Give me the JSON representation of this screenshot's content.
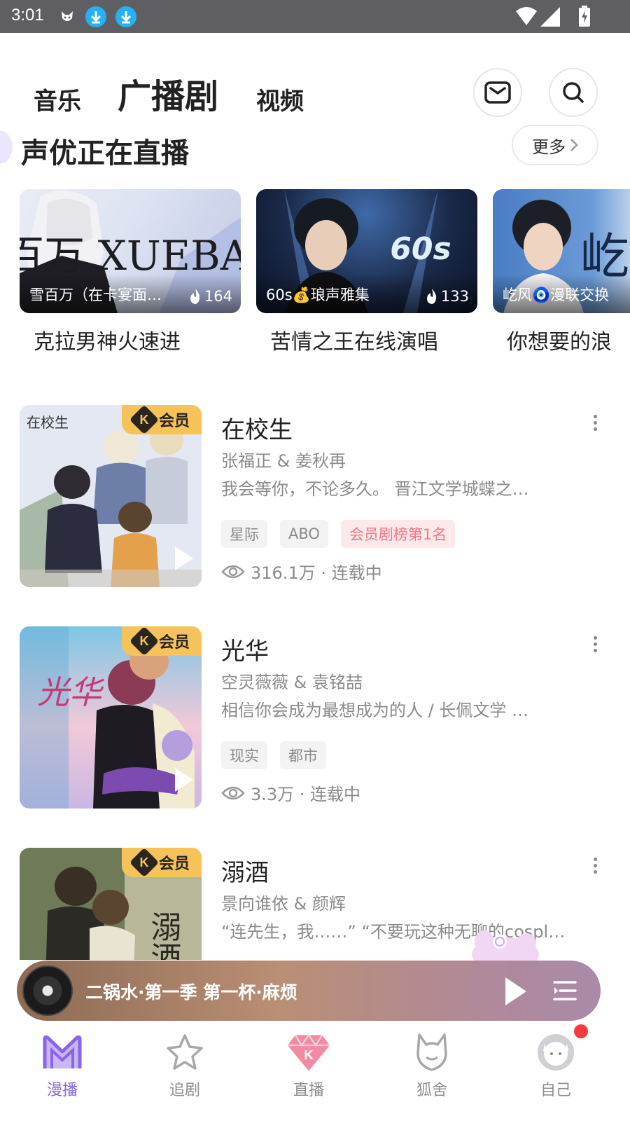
{
  "status_bar": {
    "time": "3:01"
  },
  "top_tabs": {
    "music": "音乐",
    "drama": "广播剧",
    "video": "视频"
  },
  "live": {
    "title": "声优正在直播",
    "more": "更多",
    "cards": [
      {
        "name": "雪百万（在卡宴面…",
        "count": "164",
        "desc": "克拉男神火速进",
        "cover_art": "雪百万 XUEBAIWAN"
      },
      {
        "name": "60s💰琅声雅集",
        "count": "133",
        "desc": "苦情之王在线演唱",
        "cover_art": "60s"
      },
      {
        "name": "屹风🧿漫联交换",
        "count": "",
        "desc": "你想要的浪",
        "cover_art": "屹"
      }
    ]
  },
  "dramas": [
    {
      "title": "在校生",
      "cast": "张福正 & 姜秋再",
      "desc": " 我会等你，不论多久。     晋江文学城蝶之…",
      "tags": [
        "星际",
        "ABO"
      ],
      "hot_tag": "会员剧榜第1名",
      "views": "316.1万 · 连载中",
      "vip": "会员"
    },
    {
      "title": "光华",
      "cast": "空灵薇薇 & 袁铭喆",
      "desc": "相信你会成为最想成为的人  / 长佩文学 …",
      "tags": [
        "现实",
        "都市"
      ],
      "hot_tag": "",
      "views": "3.3万 · 连载中",
      "vip": "会员"
    },
    {
      "title": "溺酒",
      "cast": "景向谁依 & 颜辉",
      "desc": "“连先生，我……” “不要玩这种无聊的cospl…",
      "tags": [],
      "hot_tag": "",
      "views": "",
      "vip": "会员"
    }
  ],
  "player": {
    "title": "二锅水·第一季 第一杯·麻烦"
  },
  "bottom_nav": [
    {
      "label": "漫播",
      "active": true
    },
    {
      "label": "追剧",
      "active": false
    },
    {
      "label": "直播",
      "active": false
    },
    {
      "label": "狐舍",
      "active": false
    },
    {
      "label": "自己",
      "active": false
    }
  ],
  "colors": {
    "accent": "#8a63ea",
    "vip_gold": "#f6c35a",
    "hot_tag_text": "#f07b86",
    "notification": "#f23a3f"
  }
}
